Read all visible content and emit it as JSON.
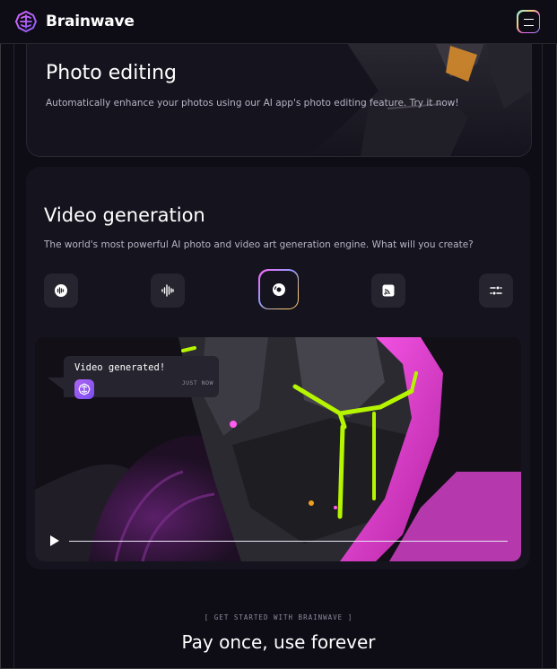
{
  "header": {
    "brand": "Brainwave",
    "logo_icon": "brainwave-logo-icon",
    "menu_icon": "hamburger-menu-icon"
  },
  "photo_card": {
    "title": "Photo editing",
    "description": "Automatically enhance your photos using our AI app's photo editing feature. Try it now!"
  },
  "video_card": {
    "title": "Video generation",
    "description": "The world's most powerful AI photo and video art generation engine. What will you create?",
    "tools": [
      {
        "icon": "voice-recognition-icon"
      },
      {
        "icon": "audio-wave-icon"
      },
      {
        "icon": "disc-icon",
        "active": true
      },
      {
        "icon": "image-cast-icon"
      },
      {
        "icon": "sliders-icon"
      }
    ],
    "chat": {
      "message": "Video generated!",
      "time": "JUST NOW"
    },
    "player": {
      "progress": 0.0
    }
  },
  "cta": {
    "eyebrow": "[  GET STARTED WITH BRAINWAVE  ]",
    "title": "Pay once, use forever"
  },
  "colors": {
    "background": "#0E0C15",
    "card": "#15131D",
    "accent_purple": "#AC6AFF",
    "accent_lime": "#B6F500",
    "accent_pink": "#E642E0"
  }
}
